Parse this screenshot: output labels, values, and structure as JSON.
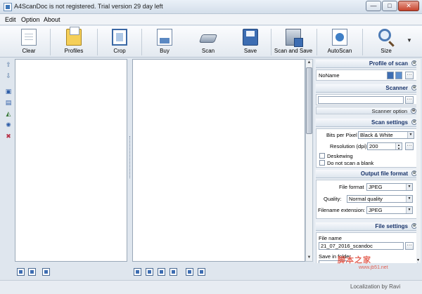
{
  "window": {
    "title": "A4ScanDoc is not registered. Trial version 29 day left",
    "min_label": "—",
    "max_label": "□",
    "close_label": "✕"
  },
  "menu": [
    "Edit",
    "Option",
    "About"
  ],
  "toolbar": {
    "clear": "Clear",
    "profiles": "Profiles",
    "crop": "Crop",
    "buy": "Buy",
    "scan": "Scan",
    "save": "Save",
    "scan_and_save": "Scan and Save",
    "autoscan": "AutoScan",
    "size": "Size",
    "dropdown_arrow": "▼"
  },
  "left_strip": {
    "up": "⇧",
    "down": "⇩",
    "icon3": "▣",
    "icon4": "▤",
    "icon5": "◭",
    "icon6": "✺",
    "icon7": "✖"
  },
  "right_panel": {
    "profile_section": {
      "title": "Profile of scan",
      "toggle": "⊕",
      "profile_name": "NoName",
      "more": "···"
    },
    "scanner_section": {
      "title": "Scanner",
      "toggle": "⊕",
      "scanner_value": "",
      "more": "···",
      "scanner_option": "Scanner option",
      "option_toggle": "⊕"
    },
    "scan_settings": {
      "title": "Scan settings",
      "toggle": "⊕",
      "bits_label": "Bits per Pixel",
      "bits_value": "Black & White",
      "resolution_label": "Resolution (dpi)",
      "resolution_value": "200",
      "more": "···",
      "deskewing": "Deskewing",
      "no_blank": "Do not scan a blank"
    },
    "output_settings": {
      "title": "Output file format",
      "toggle": "⊕",
      "format_label": "File format",
      "format_value": "JPEG",
      "quality_label": "Quality:",
      "quality_value": "Normal quality",
      "ext_label": "Filename extension:",
      "ext_value": "JPEG"
    },
    "file_settings": {
      "title": "File settings",
      "toggle": "⊕",
      "filename_label": "File name",
      "filename_value": "21_07_2016_scandoc",
      "more": "···",
      "save_in_label": "Save in folder"
    }
  },
  "status": {
    "text": "Localization by Ravi"
  },
  "watermark": {
    "text": "脚本之家",
    "url": "www.jb51.net"
  }
}
